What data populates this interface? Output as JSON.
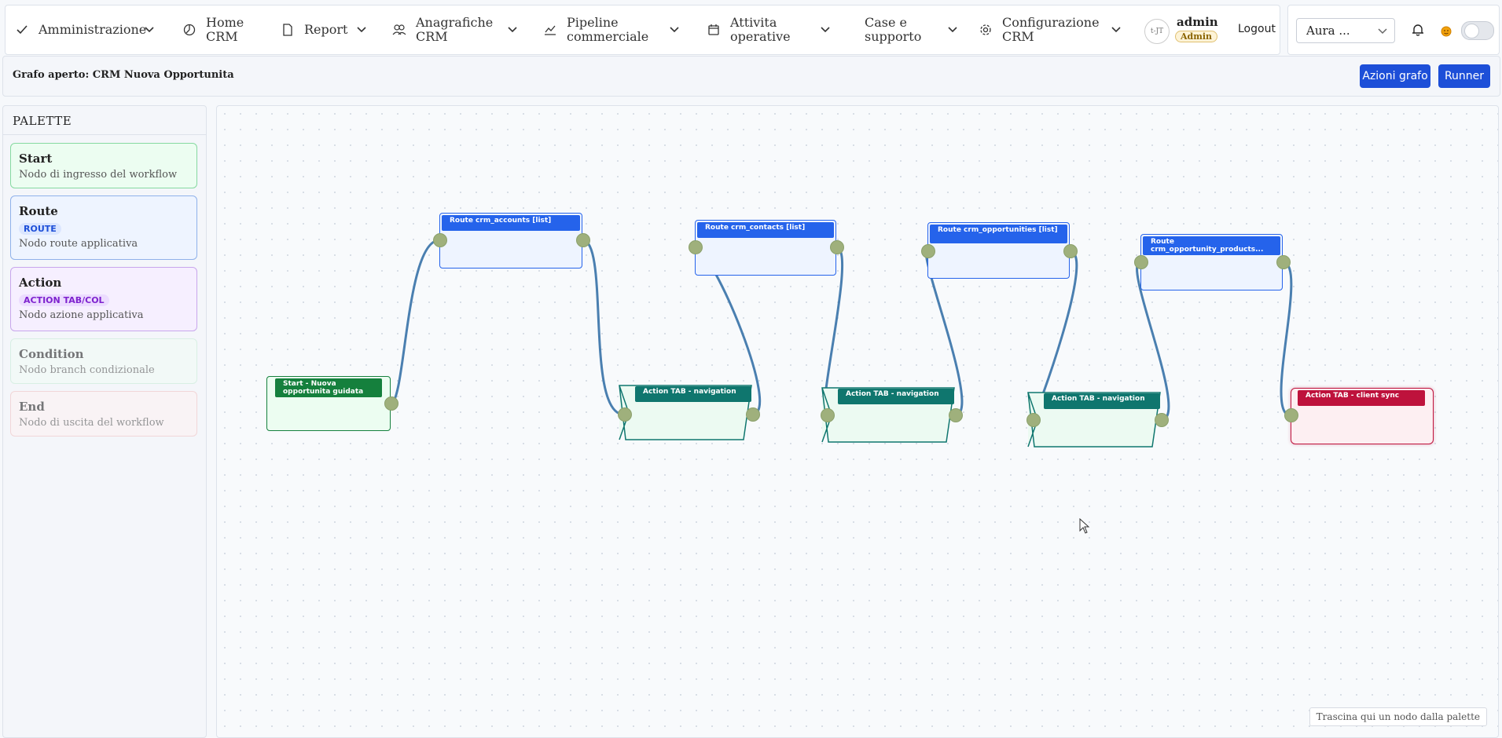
{
  "nav": {
    "items": [
      {
        "label": "Amministrazione",
        "icon": "check-icon"
      },
      {
        "label": "Home CRM",
        "icon": "gauge-icon"
      },
      {
        "label": "Report",
        "icon": "document-icon"
      },
      {
        "label": "Anagrafiche CRM",
        "icon": "users-icon"
      },
      {
        "label": "Pipeline commerciale",
        "icon": "trend-icon"
      },
      {
        "label": "Attivita operative",
        "icon": "calendar-icon"
      },
      {
        "label": "Case e supporto",
        "icon": "none"
      },
      {
        "label": "Configurazione CRM",
        "icon": "gear-icon"
      }
    ],
    "user": {
      "name": "admin",
      "role": "Admin",
      "avatar_alt": "t-JT"
    },
    "logout": "Logout"
  },
  "rightbar": {
    "theme_select": "Aura ...",
    "theme_toggle": false
  },
  "subbar": {
    "title": "Grafo aperto: CRM Nuova Opportunita",
    "actions_button": "Azioni grafo",
    "runner_button": "Runner"
  },
  "palette": {
    "title": "PALETTE",
    "items": [
      {
        "title": "Start",
        "badge": "",
        "desc": "Nodo di ingresso del workflow"
      },
      {
        "title": "Route",
        "badge": "ROUTE",
        "desc": "Nodo route applicativa"
      },
      {
        "title": "Action",
        "badge": "ACTION TAB/COL",
        "desc": "Nodo azione applicativa"
      },
      {
        "title": "Condition",
        "badge": "",
        "desc": "Nodo branch condizionale"
      },
      {
        "title": "End",
        "badge": "",
        "desc": "Nodo di uscita del workflow"
      }
    ]
  },
  "graph": {
    "nodes": [
      {
        "id": "start",
        "label": "Start - Nuova opportunita guidata",
        "kind": "start"
      },
      {
        "id": "r1",
        "label": "Route crm_accounts [list]",
        "kind": "route"
      },
      {
        "id": "a1",
        "label": "Action TAB - navigation",
        "kind": "action"
      },
      {
        "id": "r2",
        "label": "Route crm_contacts [list]",
        "kind": "route"
      },
      {
        "id": "a2",
        "label": "Action TAB - navigation",
        "kind": "action"
      },
      {
        "id": "r3",
        "label": "Route crm_opportunities [list]",
        "kind": "route"
      },
      {
        "id": "a3",
        "label": "Action TAB - navigation",
        "kind": "action"
      },
      {
        "id": "r4",
        "label": "Route crm_opportunity_products...",
        "kind": "route"
      },
      {
        "id": "end",
        "label": "Action TAB - client sync",
        "kind": "end"
      }
    ],
    "hint": "Trascina qui un nodo dalla palette"
  },
  "colors": {
    "primary": "#1d4fd8",
    "route": "#2563eb",
    "action": "#0f766e",
    "start": "#15803d",
    "end": "#be123c",
    "edge": "#4a7fb0"
  }
}
